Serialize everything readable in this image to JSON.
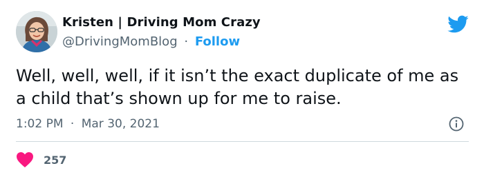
{
  "author": {
    "display_name": "Kristen | Driving Mom Crazy",
    "handle": "@DrivingMomBlog",
    "separator": "·",
    "follow_label": "Follow",
    "avatar_icon": "avatar-photo"
  },
  "brand": {
    "icon": "twitter-bird-icon",
    "color": "#1d9bf0"
  },
  "tweet": {
    "text": "Well, well, well, if it isn’t the exact duplicate of me as a child that’s shown up for me to raise.",
    "time": "1:02 PM",
    "separator": "·",
    "date": "Mar 30, 2021"
  },
  "actions": {
    "info_icon": "info-icon",
    "like_icon": "heart-icon",
    "like_color": "#f91880",
    "like_count": "257"
  }
}
